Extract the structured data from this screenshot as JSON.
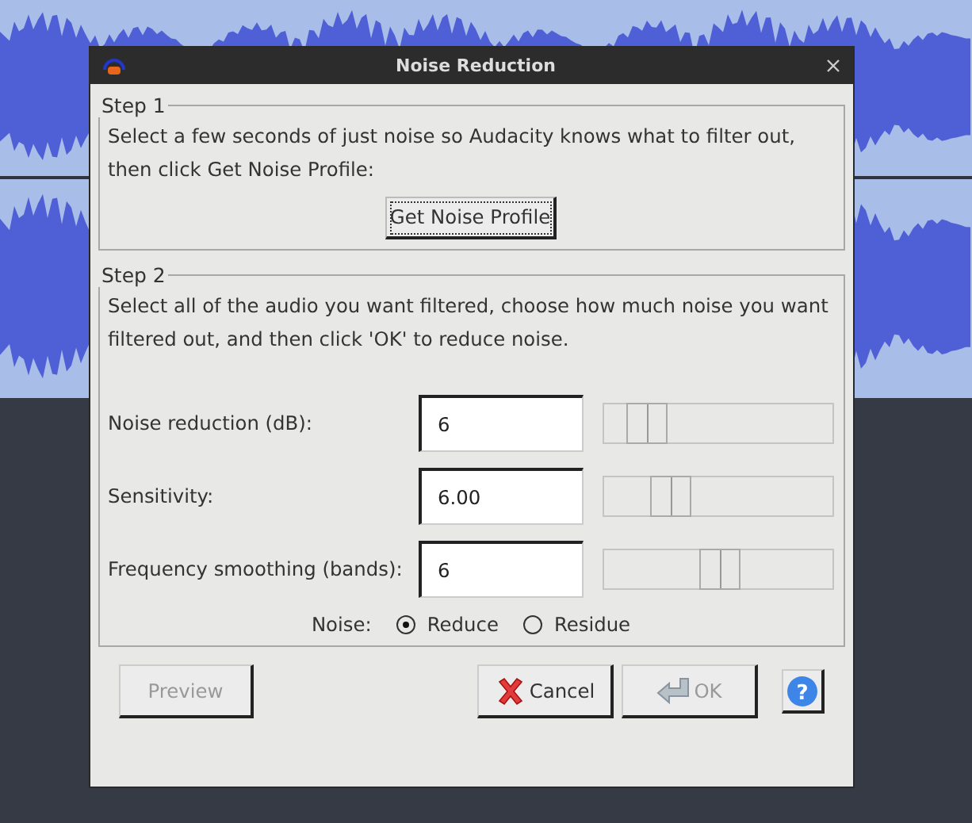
{
  "window": {
    "title": "Noise Reduction"
  },
  "step1": {
    "title": "Step 1",
    "text": "Select a few seconds of just noise so Audacity knows what to filter out, then click Get Noise Profile:",
    "button": "Get Noise Profile"
  },
  "step2": {
    "title": "Step 2",
    "text": "Select all of the audio you want filtered, choose how much noise you want filtered out, and then click 'OK' to reduce noise.",
    "params": [
      {
        "label": "Noise reduction (dB):",
        "value": "6",
        "level": 0.12
      },
      {
        "label": "Sensitivity:",
        "value": "6.00",
        "level": 0.24
      },
      {
        "label": "Frequency smoothing (bands):",
        "value": "6",
        "level": 0.5
      }
    ],
    "noise": {
      "label": "Noise:",
      "options": [
        {
          "label": "Reduce",
          "selected": true
        },
        {
          "label": "Residue",
          "selected": false
        }
      ]
    }
  },
  "buttons": [
    {
      "kind": "preview",
      "label": "Preview",
      "disabled": true
    },
    {
      "kind": "cancel",
      "label": "Cancel",
      "disabled": false
    },
    {
      "kind": "ok",
      "label": "OK",
      "disabled": true
    },
    {
      "kind": "help",
      "label": "?",
      "disabled": false
    }
  ]
}
